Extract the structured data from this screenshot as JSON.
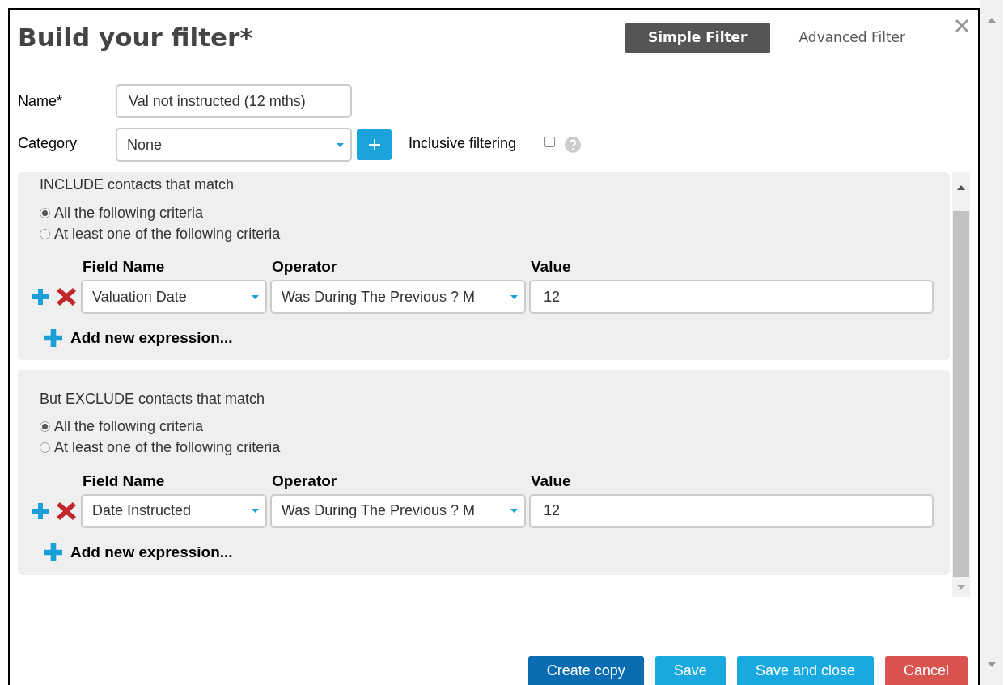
{
  "title": "Build your filter*",
  "tabs": [
    {
      "label": "Simple Filter",
      "selected": true
    },
    {
      "label": "Advanced Filter",
      "selected": false
    }
  ],
  "name": {
    "label": "Name*",
    "value": "Val not instructed (12 mths)"
  },
  "category": {
    "label": "Category",
    "value": "None"
  },
  "inclusive": {
    "label": "Inclusive filtering",
    "checked": false
  },
  "sections": [
    {
      "heading": "INCLUDE contacts that match",
      "options": [
        {
          "label": "All the following criteria",
          "selected": true
        },
        {
          "label": "At least one of the following criteria",
          "selected": false
        }
      ],
      "columns": [
        "Field Name",
        "Operator",
        "Value"
      ],
      "rows": [
        {
          "field": "Valuation Date",
          "operator": "Was During The Previous ? M",
          "value": "12"
        }
      ],
      "add_label": "Add new expression..."
    },
    {
      "heading": "But EXCLUDE contacts that match",
      "options": [
        {
          "label": "All the following criteria",
          "selected": true
        },
        {
          "label": "At least one of the following criteria",
          "selected": false
        }
      ],
      "columns": [
        "Field Name",
        "Operator",
        "Value"
      ],
      "rows": [
        {
          "field": "Date Instructed",
          "operator": "Was During The Previous ? M",
          "value": "12"
        }
      ],
      "add_label": "Add new expression..."
    }
  ],
  "buttons": [
    {
      "label": "Create copy",
      "kind": "primary"
    },
    {
      "label": "Save",
      "kind": "info"
    },
    {
      "label": "Save and close",
      "kind": "info"
    },
    {
      "label": "Cancel",
      "kind": "danger"
    }
  ]
}
